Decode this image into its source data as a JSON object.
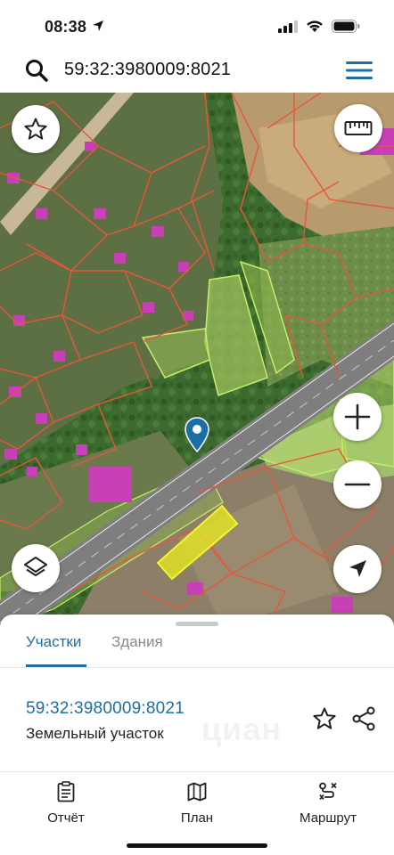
{
  "status_bar": {
    "time": "08:38"
  },
  "search": {
    "query": "59:32:3980009:8021"
  },
  "tabs": [
    {
      "label": "Участки",
      "active": true
    },
    {
      "label": "Здания",
      "active": false
    }
  ],
  "result": {
    "cadastral_number": "59:32:3980009:8021",
    "type": "Земельный участок",
    "watermark": "циан"
  },
  "bottom_nav": [
    {
      "label": "Отчёт",
      "icon": "report-icon"
    },
    {
      "label": "План",
      "icon": "map-plan-icon"
    },
    {
      "label": "Маршрут",
      "icon": "route-icon"
    }
  ],
  "colors": {
    "accent": "#1e6fa0",
    "parcel_border": "#e8563a",
    "selected_parcel": "#e9ec1e",
    "green_zone_border": "#c7ec6a",
    "road": "#7d7d7d",
    "pin": "#1b6fa6"
  }
}
